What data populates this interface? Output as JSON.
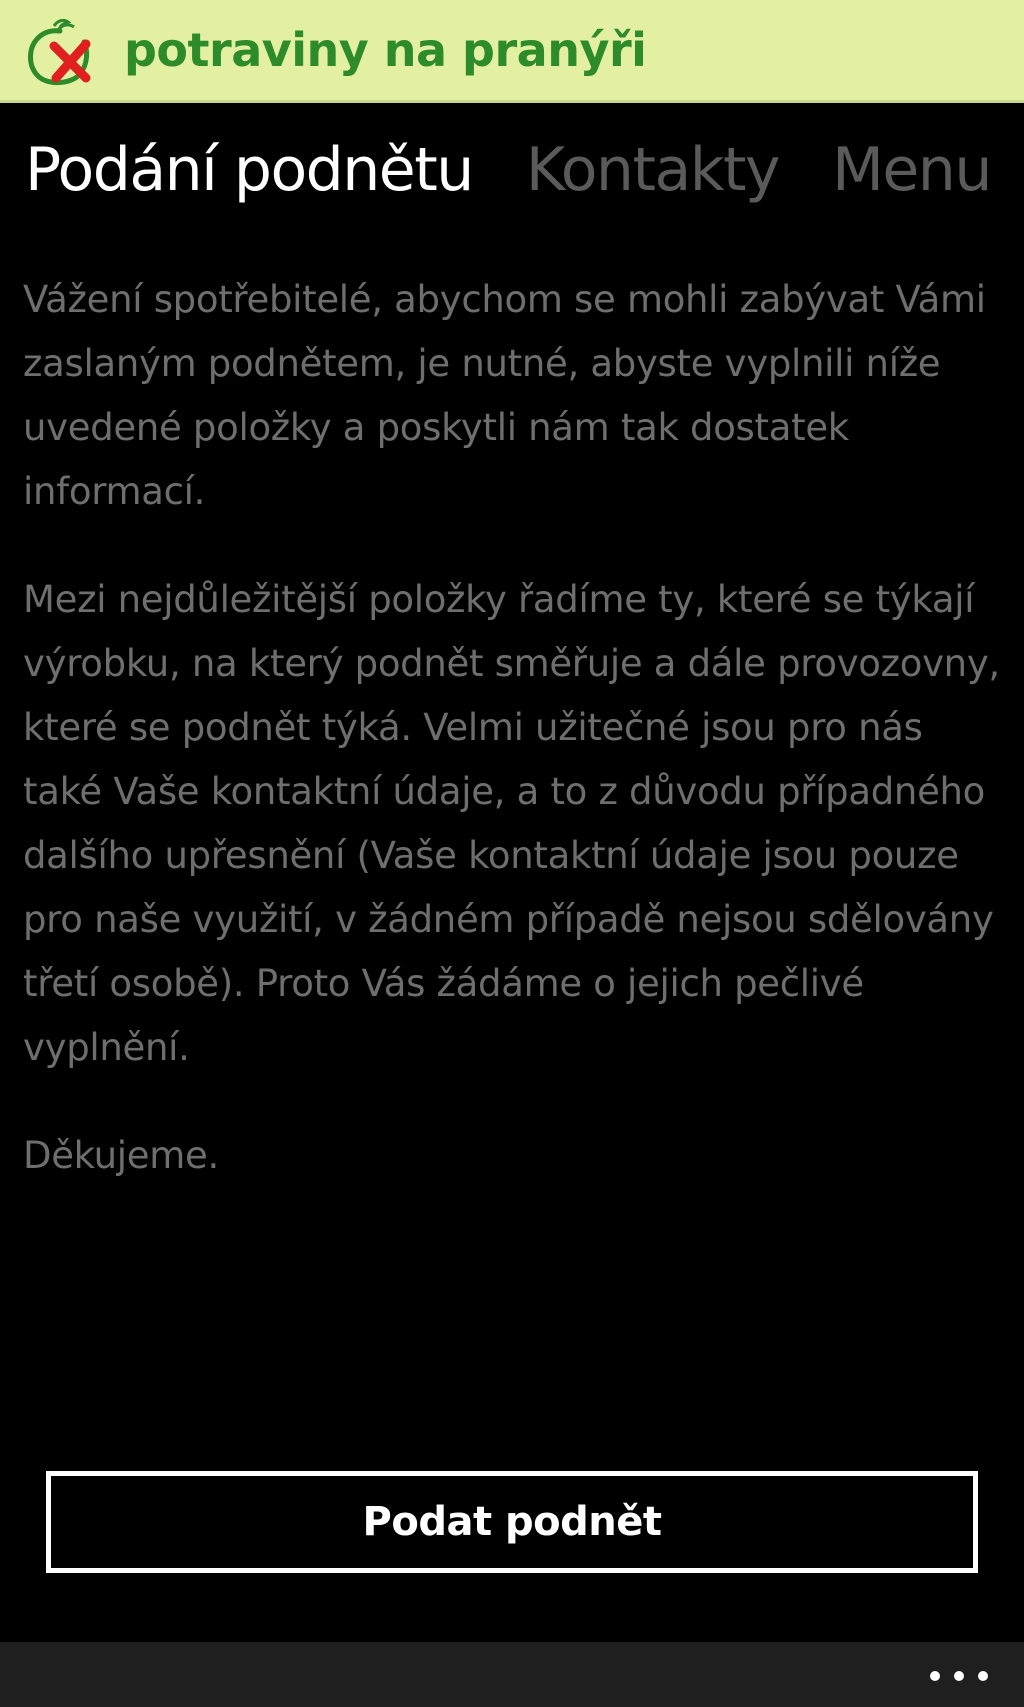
{
  "header": {
    "logo_icon": "tomato-x-icon",
    "logo_text": "potraviny na pranýři",
    "background_color": "#e3f0a3",
    "brand_color": "#2e8b2a",
    "mark_color": "#e0201f"
  },
  "tabs": [
    {
      "label": "Podání podnětu",
      "active": true
    },
    {
      "label": "Kontakty",
      "active": false
    },
    {
      "label": "Menu",
      "active": false
    }
  ],
  "content": {
    "paragraphs": [
      "Vážení spotřebitelé, abychom se mohli zabývat Vámi zaslaným podnětem, je nutné, abyste vyplnili níže uvedené položky a poskytli nám tak dostatek informací.",
      "Mezi nejdůležitější položky řadíme ty, které se týkají výrobku, na který podnět směřuje a dále provozovny, které se podnět týká. Velmi užitečné jsou pro nás také Vaše kontaktní údaje, a to z důvodu případného dalšího upřesnění (Vaše kontaktní údaje jsou pouze pro naše využití, v žádném případě nejsou sdělovány třetí osobě). Proto Vás žádáme o jejich pečlivé vyplnění.",
      "Děkujeme."
    ]
  },
  "submit_button": {
    "label": "Podat podnět"
  },
  "app_bar": {
    "more_icon": "ellipsis-icon"
  }
}
